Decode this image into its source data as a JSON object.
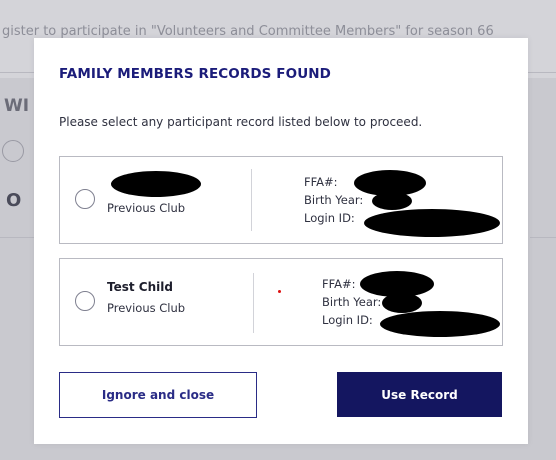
{
  "background": {
    "title": "",
    "subtitle": "gister to participate in \"Volunteers and Committee Members\" for season 66",
    "section_label": "WI",
    "section_label2": "O"
  },
  "modal": {
    "title": "FAMILY MEMBERS RECORDS FOUND",
    "instruction": "Please select any participant record listed below to proceed.",
    "records": [
      {
        "name": "",
        "club": "Previous Club",
        "ffa_label": "FFA#:",
        "birth_year_label": "Birth Year:",
        "login_id_label": "Login ID:"
      },
      {
        "name": "Test Child",
        "club": "Previous Club",
        "ffa_label": "FFA#:",
        "birth_year_label": "Birth Year:",
        "login_id_label": "Login ID:"
      }
    ],
    "buttons": {
      "ignore": "Ignore and close",
      "use": "Use Record"
    }
  },
  "colors": {
    "brand_navy": "#141660",
    "title_blue": "#1b1c7a",
    "redaction": "#000000"
  }
}
